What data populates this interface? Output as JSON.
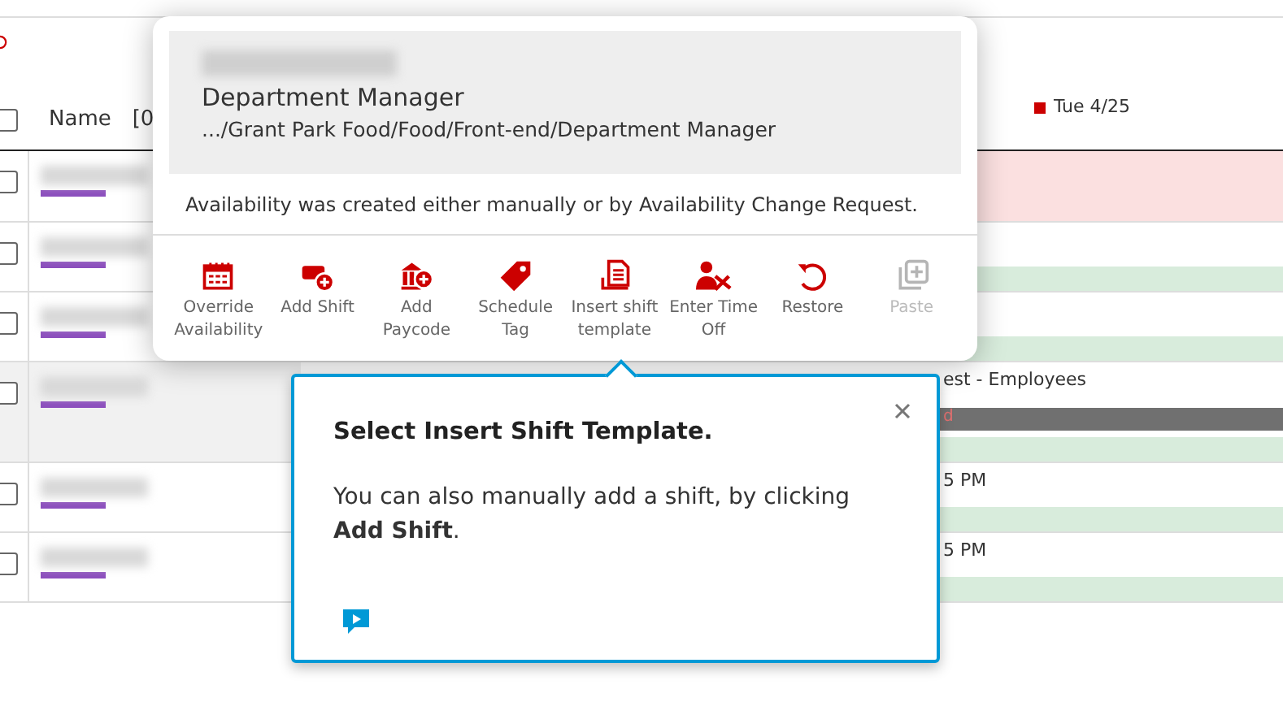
{
  "grid": {
    "header": {
      "checked": false,
      "name_label": "Name",
      "column_2": "[0",
      "day_label": "Tue 4/25"
    },
    "rows": [
      {
        "checked": false,
        "selected": false,
        "day_cells": [
          {
            "kind": "unavailable"
          }
        ]
      },
      {
        "checked": false,
        "selected": false,
        "day_cells": [
          {
            "kind": "available"
          }
        ]
      },
      {
        "checked": false,
        "selected": false,
        "day_cells": [
          {
            "kind": "available"
          }
        ]
      },
      {
        "checked": false,
        "selected": true,
        "day_cells": [
          {
            "kind": "text",
            "text": "est - Employees"
          },
          {
            "kind": "bar",
            "text": "d"
          },
          {
            "kind": "available"
          }
        ]
      },
      {
        "checked": false,
        "selected": false,
        "day_cells": [
          {
            "kind": "text",
            "text": "5 PM"
          },
          {
            "kind": "available"
          }
        ]
      },
      {
        "checked": false,
        "selected": false,
        "day_cells": [
          {
            "kind": "text",
            "text": "5 PM"
          },
          {
            "kind": "available"
          }
        ]
      }
    ]
  },
  "popup": {
    "title": "Department Manager",
    "path": ".../Grant Park Food/Food/Front-end/Department Manager",
    "message": "Availability was created either manually or by Availability Change Request.",
    "actions": [
      {
        "kind": "calendar",
        "label": "Override Availability",
        "disabled": false
      },
      {
        "kind": "shift",
        "label": "Add Shift",
        "disabled": false
      },
      {
        "kind": "paycode",
        "label": "Add Paycode",
        "disabled": false
      },
      {
        "kind": "tag",
        "label": "Schedule Tag",
        "disabled": false
      },
      {
        "kind": "template",
        "label": "Insert shift template",
        "disabled": false
      },
      {
        "kind": "timeoff",
        "label": "Enter Time Off",
        "disabled": false
      },
      {
        "kind": "restore",
        "label": "Restore",
        "disabled": false
      },
      {
        "kind": "paste",
        "label": "Paste",
        "disabled": true
      }
    ]
  },
  "tooltip": {
    "title": "Select Insert Shift Template.",
    "body": "You can also manually add a shift, by clicking **Add Shift**."
  }
}
